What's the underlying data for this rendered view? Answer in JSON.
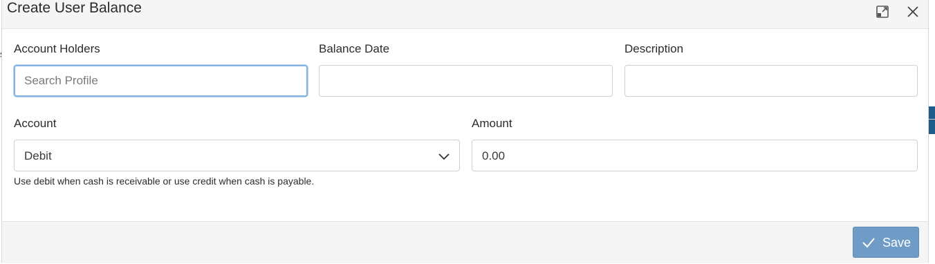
{
  "modal": {
    "title": "Create User Balance"
  },
  "background": {
    "fragment": "s"
  },
  "header": {
    "expand_icon": "expand-icon",
    "close_icon": "close-icon"
  },
  "fields": {
    "account_holders": {
      "label": "Account Holders",
      "placeholder": "Search Profile",
      "value": ""
    },
    "balance_date": {
      "label": "Balance Date",
      "value": ""
    },
    "description": {
      "label": "Description",
      "value": ""
    },
    "account": {
      "label": "Account",
      "selected": "Debit",
      "help": "Use debit when cash is receivable or use credit when cash is payable."
    },
    "amount": {
      "label": "Amount",
      "value": "0.00"
    }
  },
  "footer": {
    "save_label": "Save",
    "save_icon": "check-icon"
  },
  "colors": {
    "primary_button": "#6f9bc7",
    "focus_border": "#86b4e3",
    "header_bg": "#f5f5f5"
  }
}
